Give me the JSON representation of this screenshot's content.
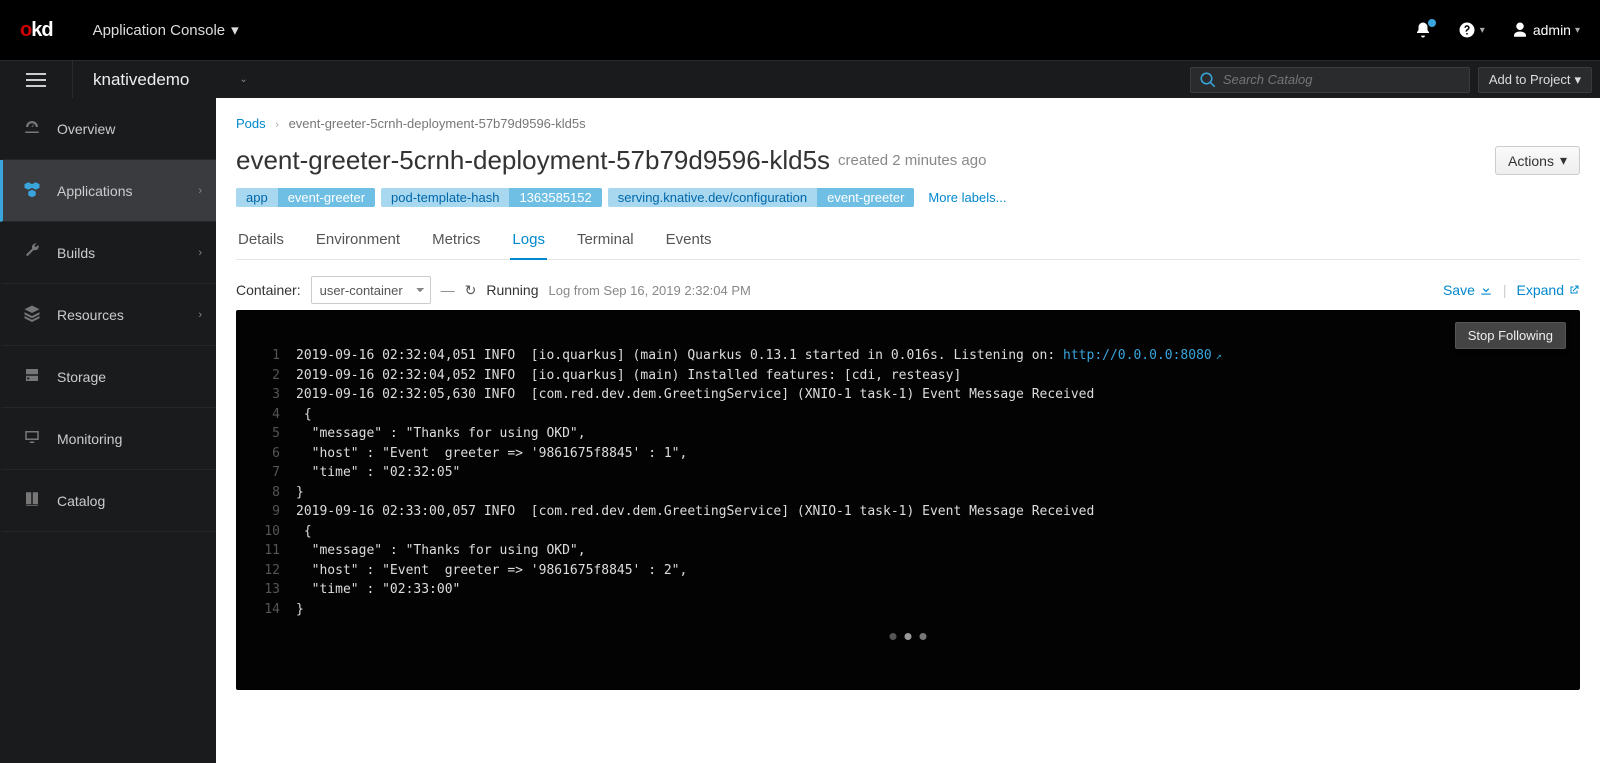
{
  "logo": {
    "left": "o",
    "right": "kd"
  },
  "header": {
    "console_label": "Application Console",
    "user": "admin"
  },
  "projectbar": {
    "project": "knativedemo",
    "search_placeholder": "Search Catalog",
    "add_label": "Add to Project"
  },
  "sidebar": {
    "items": [
      {
        "label": "Overview",
        "icon": "dashboard",
        "expandable": false
      },
      {
        "label": "Applications",
        "icon": "cubes",
        "expandable": true,
        "active": true
      },
      {
        "label": "Builds",
        "icon": "wrench",
        "expandable": true
      },
      {
        "label": "Resources",
        "icon": "layers",
        "expandable": true
      },
      {
        "label": "Storage",
        "icon": "drive",
        "expandable": false
      },
      {
        "label": "Monitoring",
        "icon": "monitor",
        "expandable": false
      },
      {
        "label": "Catalog",
        "icon": "book",
        "expandable": false
      }
    ]
  },
  "breadcrumb": {
    "root": "Pods",
    "current": "event-greeter-5crnh-deployment-57b79d9596-kld5s"
  },
  "page": {
    "title": "event-greeter-5crnh-deployment-57b79d9596-kld5s",
    "created": "created 2 minutes ago",
    "actions": "Actions",
    "more_labels": "More labels...",
    "labels": [
      {
        "k": "app",
        "v": "event-greeter"
      },
      {
        "k": "pod-template-hash",
        "v": "1363585152"
      },
      {
        "k": "serving.knative.dev/configuration",
        "v": "event-greeter"
      }
    ],
    "tabs": [
      "Details",
      "Environment",
      "Metrics",
      "Logs",
      "Terminal",
      "Events"
    ],
    "active_tab": "Logs"
  },
  "logs": {
    "container_label": "Container:",
    "container_value": "user-container",
    "status": "Running",
    "from": "Log from Sep 16, 2019 2:32:04 PM",
    "save": "Save",
    "expand": "Expand",
    "stop_follow": "Stop Following",
    "link_text": "http://0.0.0.0:8080",
    "lines": [
      {
        "n": 1,
        "t": "2019-09-16 02:32:04,051 INFO  [io.quarkus] (main) Quarkus 0.13.1 started in 0.016s. Listening on: ",
        "link": true
      },
      {
        "n": 2,
        "t": "2019-09-16 02:32:04,052 INFO  [io.quarkus] (main) Installed features: [cdi, resteasy]"
      },
      {
        "n": 3,
        "t": "2019-09-16 02:32:05,630 INFO  [com.red.dev.dem.GreetingService] (XNIO-1 task-1) Event Message Received "
      },
      {
        "n": 4,
        "t": " {"
      },
      {
        "n": 5,
        "t": "  \"message\" : \"Thanks for using OKD\","
      },
      {
        "n": 6,
        "t": "  \"host\" : \"Event  greeter => '9861675f8845' : 1\","
      },
      {
        "n": 7,
        "t": "  \"time\" : \"02:32:05\""
      },
      {
        "n": 8,
        "t": "}"
      },
      {
        "n": 9,
        "t": "2019-09-16 02:33:00,057 INFO  [com.red.dev.dem.GreetingService] (XNIO-1 task-1) Event Message Received "
      },
      {
        "n": 10,
        "t": " {"
      },
      {
        "n": 11,
        "t": "  \"message\" : \"Thanks for using OKD\","
      },
      {
        "n": 12,
        "t": "  \"host\" : \"Event  greeter => '9861675f8845' : 2\","
      },
      {
        "n": 13,
        "t": "  \"time\" : \"02:33:00\""
      },
      {
        "n": 14,
        "t": "}"
      }
    ]
  }
}
